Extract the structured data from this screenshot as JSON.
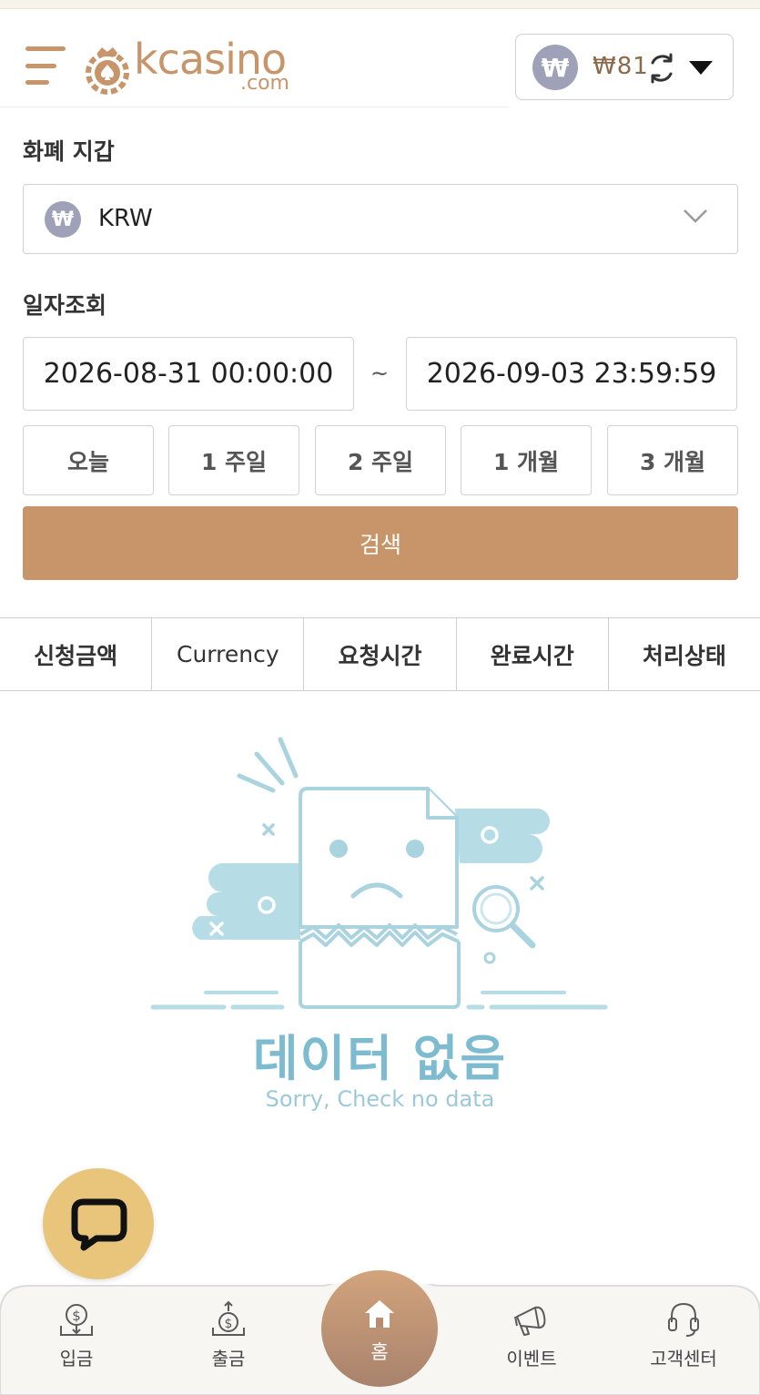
{
  "header": {
    "logo_text": "kcasino",
    "logo_sub": ".com",
    "wallet_symbol": "₩",
    "wallet_amount": "₩81"
  },
  "wallet_section": {
    "label": "화폐 지갑",
    "currency_symbol": "₩",
    "currency_selected": "KRW"
  },
  "date_section": {
    "label": "일자조회",
    "start": "2026-08-31 00:00:00",
    "separator": "~",
    "end": "2026-09-03 23:59:59"
  },
  "range_buttons": [
    "오늘",
    "1 주일",
    "2 주일",
    "1 개월",
    "3 개월"
  ],
  "search_label": "검색",
  "table_headers": [
    "신청금액",
    "Currency",
    "요청시간",
    "완료시간",
    "처리상태"
  ],
  "empty_state": {
    "title": "데이터 없음",
    "subtitle": "Sorry, Check no data"
  },
  "bottom_nav": {
    "deposit": "입금",
    "withdraw": "출금",
    "home": "홈",
    "event": "이벤트",
    "support": "고객센터"
  },
  "colors": {
    "accent": "#c8956a",
    "chat": "#e8c57a",
    "empty": "#7dbcd0",
    "badge": "#9ea1b8"
  },
  "icons": [
    "menu-icon",
    "casino-chip-icon",
    "won-icon",
    "refresh-icon",
    "caret-down-icon",
    "chevron-down-icon",
    "chat-icon",
    "deposit-icon",
    "withdraw-icon",
    "home-icon",
    "megaphone-icon",
    "headset-icon"
  ]
}
